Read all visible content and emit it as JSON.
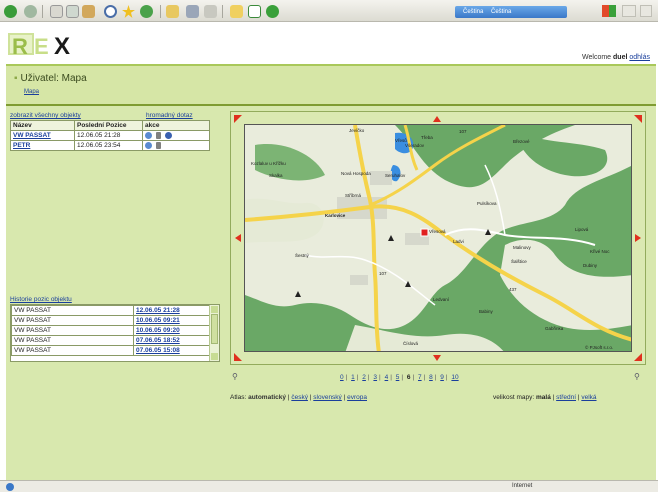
{
  "browser": {
    "tabs": [
      "Čeština",
      "Čeština"
    ]
  },
  "header": {
    "logo_text": "REX",
    "welcome_prefix": "Welcome",
    "user": "duel",
    "logout": "odhlás",
    "title": "Uživatel: Mapa",
    "breadcrumb": "Mapa"
  },
  "objects": {
    "show_all_link": "zobrazit všechny objekty",
    "bulk_query_link": "hromadný dotaz",
    "columns": [
      "Název",
      "Poslední Pozice",
      "akce"
    ],
    "rows": [
      {
        "name": "VW PASSAT",
        "position": "12.06.05 21:28"
      },
      {
        "name": "PETR",
        "position": "12.06.05 23:54"
      }
    ]
  },
  "history": {
    "title": "Historie pozic objektu",
    "rows": [
      {
        "name": "VW PASSAT",
        "date": "12.06.05 21:28"
      },
      {
        "name": "VW PASSAT",
        "date": "10.06.05 09:21"
      },
      {
        "name": "VW PASSAT",
        "date": "10.06.05 09:20"
      },
      {
        "name": "VW PASSAT",
        "date": "07.06.05 18:52"
      },
      {
        "name": "VW PASSAT",
        "date": "07.06.05 15:08"
      }
    ]
  },
  "map": {
    "places": [
      "Jevíčko",
      "Vřesů",
      "Třeba",
      "Všeradov",
      "Březové",
      "Kozlaluv u Křížku",
      "Nová Hospoda",
      "Seruhalov",
      "Skalka",
      "Stříbrná",
      "Karlovice",
      "Pulsíkova",
      "Lipová",
      "Vřesová",
      "Ladvi",
      "Malinovy",
      "Křivé Noc",
      "Dubiny",
      "Ledvaní",
      "Babiny",
      "Číslová",
      "Gabřinka",
      "Šestný",
      "Šalštice"
    ],
    "copyright": "© PJsoft s.r.o.",
    "road_numbers": [
      "107",
      "107",
      "437"
    ],
    "marker": "Vřesová"
  },
  "pagination": {
    "pages": [
      "0",
      "1",
      "2",
      "3",
      "4",
      "5",
      "6",
      "7",
      "8",
      "9",
      "10"
    ],
    "current": "6"
  },
  "atlas": {
    "label": "Atlas:",
    "current": "automatický",
    "options": [
      "český",
      "slovenský",
      "evropa"
    ]
  },
  "mapsize": {
    "label": "velikost mapy:",
    "current": "malá",
    "options": [
      "střední",
      "velká"
    ]
  },
  "statusbar": {
    "zone": "Internet"
  },
  "colors": {
    "accent_green": "#7f9c32",
    "band_green": "#d6e6a6",
    "link_blue": "#1a3f9c",
    "arrow_red": "#e0301e"
  }
}
